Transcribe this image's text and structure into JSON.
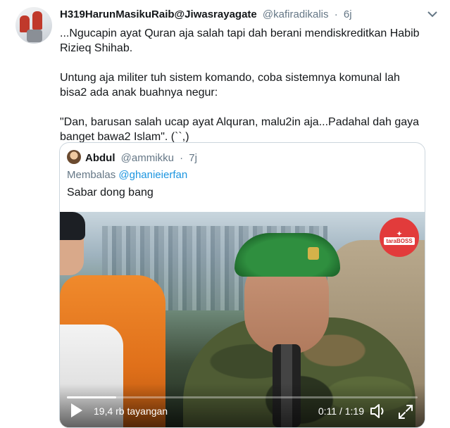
{
  "tweet": {
    "display_name": "H319HarunMasikuRaib@Jiwasrayagate",
    "handle": "@kafiradikalis",
    "separator": "·",
    "time": "6j",
    "paragraphs": [
      "...Ngucapin ayat Quran aja salah tapi dah berani mendiskreditkan Habib Rizieq Shihab.",
      "Untung aja militer tuh sistem komando, coba sistemnya komunal lah bisa2 ada anak buahnya negur:",
      "\"Dan, barusan salah ucap ayat Alquran, malu2in aja...Padahal dah gaya banget bawa2 Islam\". (``,)"
    ],
    "caret_icon": "chevron-down-icon"
  },
  "quoted": {
    "display_name": "Abdul",
    "handle": "@ammikku",
    "separator": "·",
    "time": "7j",
    "reply_prefix": "Membalas",
    "reply_to": "@ghanieierfan",
    "text": "Sabar dong bang",
    "video": {
      "logo_text": "taraBOSS",
      "views": "19,4 rb tayangan",
      "time": "0:11 / 1:19",
      "progress": 0.14
    }
  }
}
